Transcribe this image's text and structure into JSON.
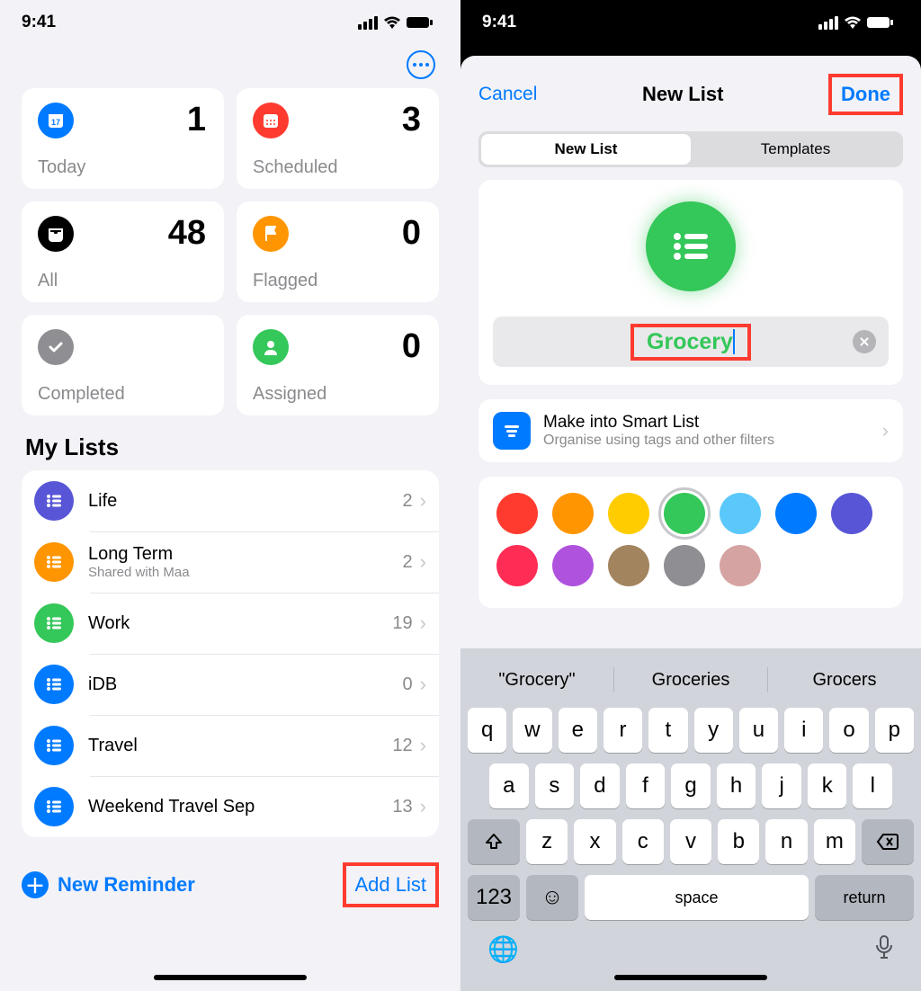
{
  "status": {
    "time": "9:41"
  },
  "left": {
    "summary": [
      {
        "label": "Today",
        "count": "1",
        "color": "#007aff",
        "icon": "calendar"
      },
      {
        "label": "Scheduled",
        "count": "3",
        "color": "#ff3b30",
        "icon": "calendar"
      },
      {
        "label": "All",
        "count": "48",
        "color": "#000000",
        "icon": "tray"
      },
      {
        "label": "Flagged",
        "count": "0",
        "color": "#ff9500",
        "icon": "flag"
      },
      {
        "label": "Completed",
        "count": "",
        "color": "#8e8e93",
        "icon": "check"
      },
      {
        "label": "Assigned",
        "count": "0",
        "color": "#34c759",
        "icon": "person"
      }
    ],
    "my_lists_title": "My Lists",
    "lists": [
      {
        "name": "Life",
        "sub": "",
        "count": "2",
        "color": "#5856d6"
      },
      {
        "name": "Long Term",
        "sub": "Shared with Maa",
        "count": "2",
        "color": "#ff9500"
      },
      {
        "name": "Work",
        "sub": "",
        "count": "19",
        "color": "#34c759"
      },
      {
        "name": "iDB",
        "sub": "",
        "count": "0",
        "color": "#007aff"
      },
      {
        "name": "Travel",
        "sub": "",
        "count": "12",
        "color": "#007aff"
      },
      {
        "name": "Weekend Travel Sep",
        "sub": "",
        "count": "13",
        "color": "#007aff"
      }
    ],
    "footer": {
      "new_reminder": "New Reminder",
      "add_list": "Add List"
    }
  },
  "right": {
    "cancel": "Cancel",
    "title": "New List",
    "done": "Done",
    "segments": {
      "new_list": "New List",
      "templates": "Templates"
    },
    "preview": {
      "color": "#34c759",
      "name": "Grocery"
    },
    "smart": {
      "title": "Make into Smart List",
      "sub": "Organise using tags and other filters"
    },
    "colors_row1": [
      "#ff3b30",
      "#ff9500",
      "#ffcc00",
      "#34c759",
      "#5ac8fa",
      "#007aff",
      "#5856d6"
    ],
    "colors_row2": [
      "#ff2d55",
      "#af52de",
      "#a2845e",
      "#8e8e93",
      "#d6a3a3"
    ],
    "selected_color_index": 3,
    "suggestions": [
      "\"Grocery\"",
      "Groceries",
      "Grocers"
    ],
    "keyboard": {
      "r1": [
        "q",
        "w",
        "e",
        "r",
        "t",
        "y",
        "u",
        "i",
        "o",
        "p"
      ],
      "r2": [
        "a",
        "s",
        "d",
        "f",
        "g",
        "h",
        "j",
        "k",
        "l"
      ],
      "r3": [
        "z",
        "x",
        "c",
        "v",
        "b",
        "n",
        "m"
      ],
      "numbers": "123",
      "space": "space",
      "ret": "return"
    }
  }
}
